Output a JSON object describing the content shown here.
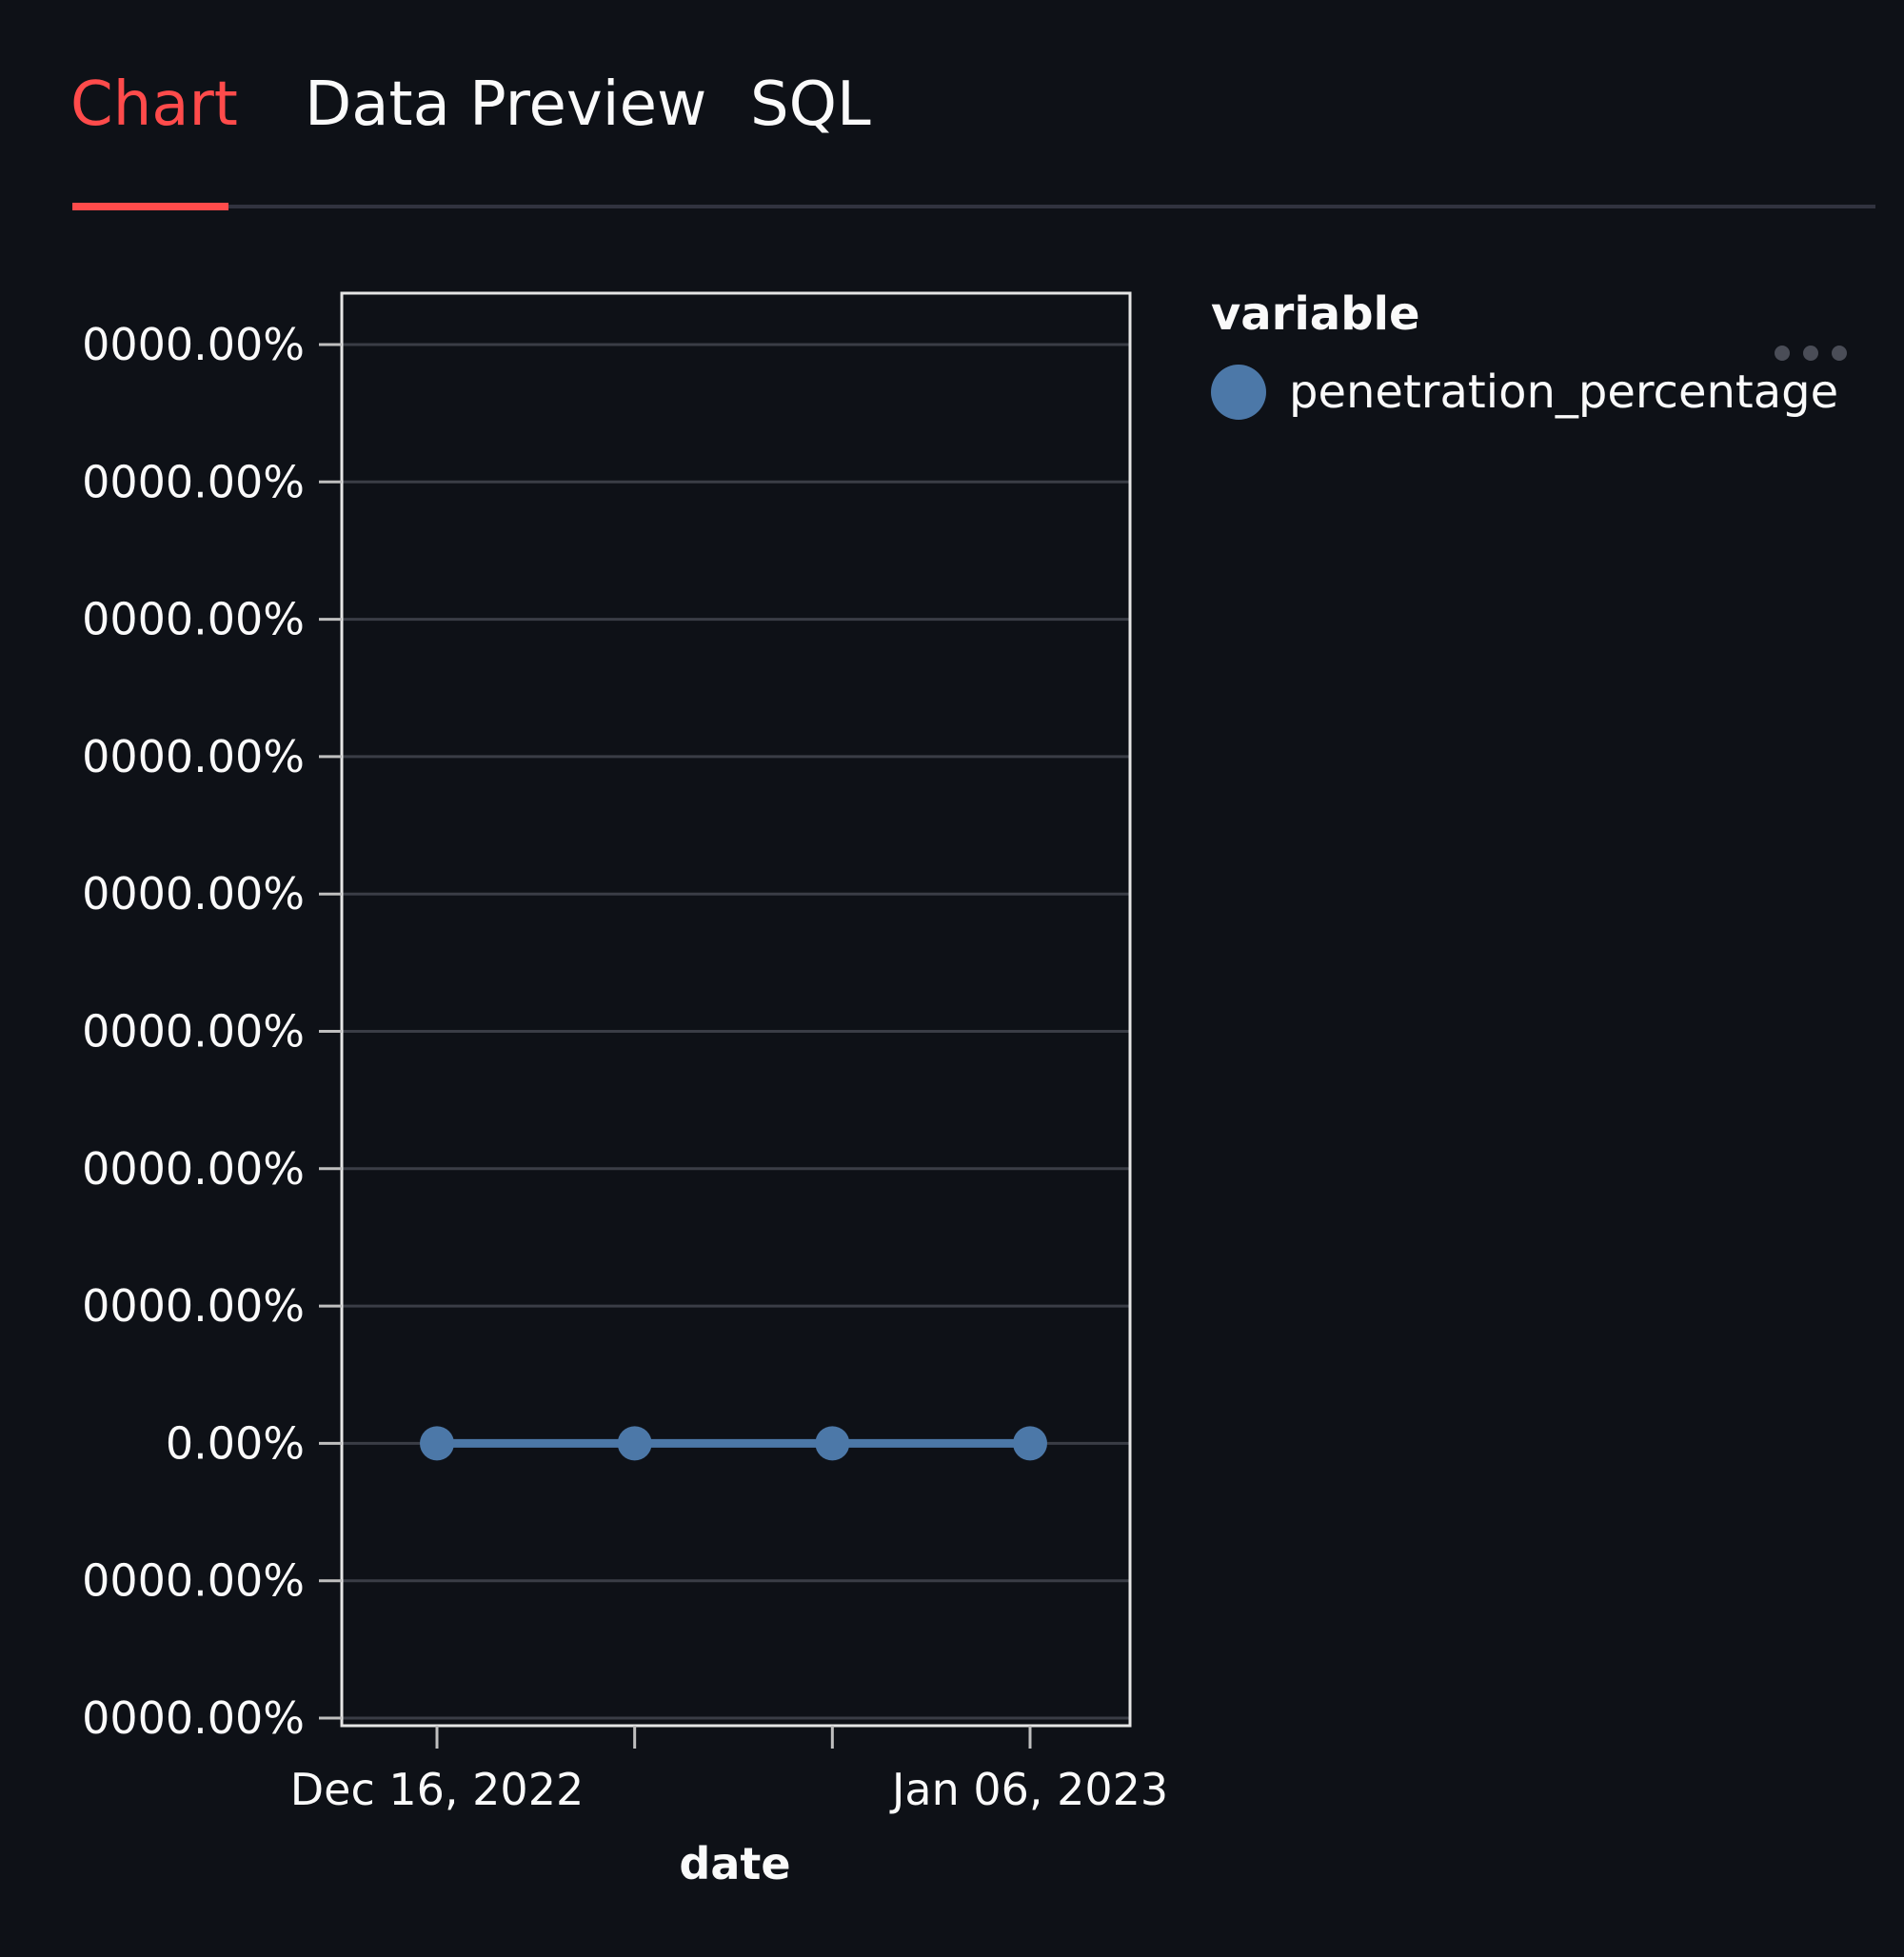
{
  "tabs": [
    {
      "label": "Chart",
      "active": true
    },
    {
      "label": "Data Preview",
      "active": false
    },
    {
      "label": "SQL",
      "active": false
    }
  ],
  "colors": {
    "background": "#0e1117",
    "accent": "#ff4b4b",
    "series": "#4c78a8",
    "text": "#fafafa",
    "grid": "#3a3d46"
  },
  "more_menu_icon": "ellipsis-icon",
  "chart_data": {
    "type": "line",
    "xlabel": "date",
    "ylabel": "",
    "x_tick_labels": [
      "Dec 16, 2022",
      "",
      "",
      "Jan 06, 2023"
    ],
    "y_tick_labels": [
      "0000.00%",
      "0000.00%",
      "0000.00%",
      "0000.00%",
      "0000.00%",
      "0000.00%",
      "0000.00%",
      "0000.00%",
      "0.00%",
      "0000.00%",
      "0000.00%"
    ],
    "legend_title": "variable",
    "legend_position": "right",
    "grid": true,
    "x": [
      "2022-12-16",
      "2022-12-23",
      "2022-12-30",
      "2023-01-06"
    ],
    "series": [
      {
        "name": "penetration_percentage",
        "values": [
          0,
          0,
          0,
          0
        ]
      }
    ]
  }
}
